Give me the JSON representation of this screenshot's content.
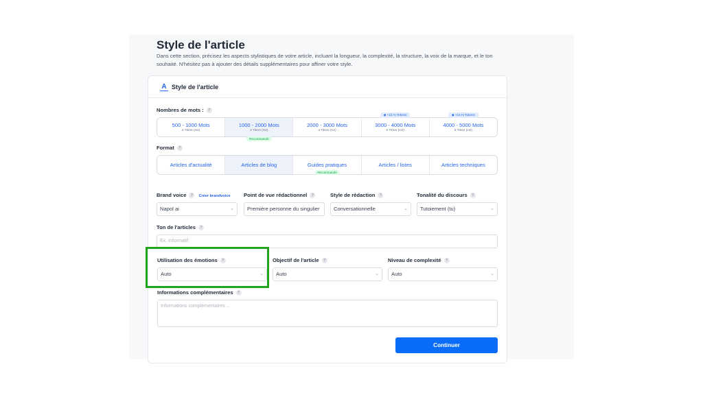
{
  "title": "Style de l'article",
  "description": "Dans cette section, précisez les aspects stylistiques de votre article, incluant la longueur, la complexité, la structure, la voix de la marque, et le ton souhaité. N'hésitez pas à ajouter des détails supplémentaires pour affiner votre style.",
  "card": {
    "title": "Style de l'article",
    "icon": "text-style-icon"
  },
  "word_count": {
    "label": "Nombres de mots :",
    "options": [
      {
        "main": "500 - 1000 Mots",
        "sub": "2 Titres (H2)"
      },
      {
        "main": "1000 - 2000 Mots",
        "sub": "3 Titres (H2)",
        "badge": "Recommandé",
        "selected": true
      },
      {
        "main": "2000 - 3000 Mots",
        "sub": "4 Titres (H2)"
      },
      {
        "main": "3000 - 4000 Mots",
        "sub": "5 Titres (H2)",
        "token": "+10 AI Tokens"
      },
      {
        "main": "4000 - 5000 Mots",
        "sub": "6 Titres (H2)",
        "token": "+15 AI Tokens"
      }
    ]
  },
  "format": {
    "label": "Format",
    "options": [
      {
        "main": "Articles d'actualité"
      },
      {
        "main": "Articles de blog",
        "selected": true
      },
      {
        "main": "Guides pratiques",
        "badge": "Recommandé"
      },
      {
        "main": "Articles / listes"
      },
      {
        "main": "Articles techniques"
      }
    ]
  },
  "brand_voice": {
    "label": "Brand voice",
    "link": "Créer brandvoice",
    "value": "Napol ai"
  },
  "point_of_view": {
    "label": "Point de vue rédactionnel",
    "value": "Première personne du singulier"
  },
  "writing_style": {
    "label": "Style de rédaction",
    "value": "Conversationnelle"
  },
  "tone": {
    "label": "Tonalité du discours",
    "value": "Tutoiement (tu)"
  },
  "article_tone": {
    "label": "Ton de l'articles",
    "placeholder": "Ex. Informatif"
  },
  "emotions": {
    "label": "Utilisation des émotions",
    "value": "Auto"
  },
  "objective": {
    "label": "Objectif de l'article",
    "value": "Auto"
  },
  "complexity": {
    "label": "Niveau de complexité",
    "value": "Auto"
  },
  "additional": {
    "label": "Informations complémentaires",
    "placeholder": "Informations complémentaires ..."
  },
  "continue_label": "Continuer",
  "colors": {
    "accent": "#0a6dfa",
    "highlight": "#22a51c",
    "recommended": "#16a34a"
  }
}
